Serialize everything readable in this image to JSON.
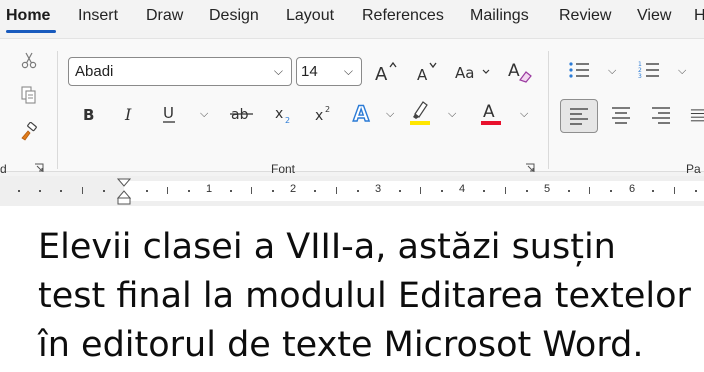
{
  "tabs": [
    {
      "label": "Home",
      "active": true
    },
    {
      "label": "Insert"
    },
    {
      "label": "Draw"
    },
    {
      "label": "Design"
    },
    {
      "label": "Layout"
    },
    {
      "label": "References"
    },
    {
      "label": "Mailings"
    },
    {
      "label": "Review"
    },
    {
      "label": "View"
    },
    {
      "label": "H"
    }
  ],
  "ribbon": {
    "clipboard_label_fragment": "d",
    "font_group": {
      "label": "Font",
      "font_name": "Abadi",
      "font_size": "14"
    },
    "paragraph_label_fragment": "Pa",
    "underline_color": "#1f1f1f",
    "highlight_color": "#ffe600",
    "font_color": "#e8112d",
    "text_effects_color": "#2b7bd6",
    "accent": "#185abd"
  },
  "ruler": {
    "numbers": [
      "1",
      "2",
      "3",
      "4",
      "5",
      "6"
    ]
  },
  "document": {
    "text": "Elevii clasei a VIII-a, astăzi susțin\ntest final la modulul Editarea textelor\nîn editorul de texte Microsot Word."
  }
}
